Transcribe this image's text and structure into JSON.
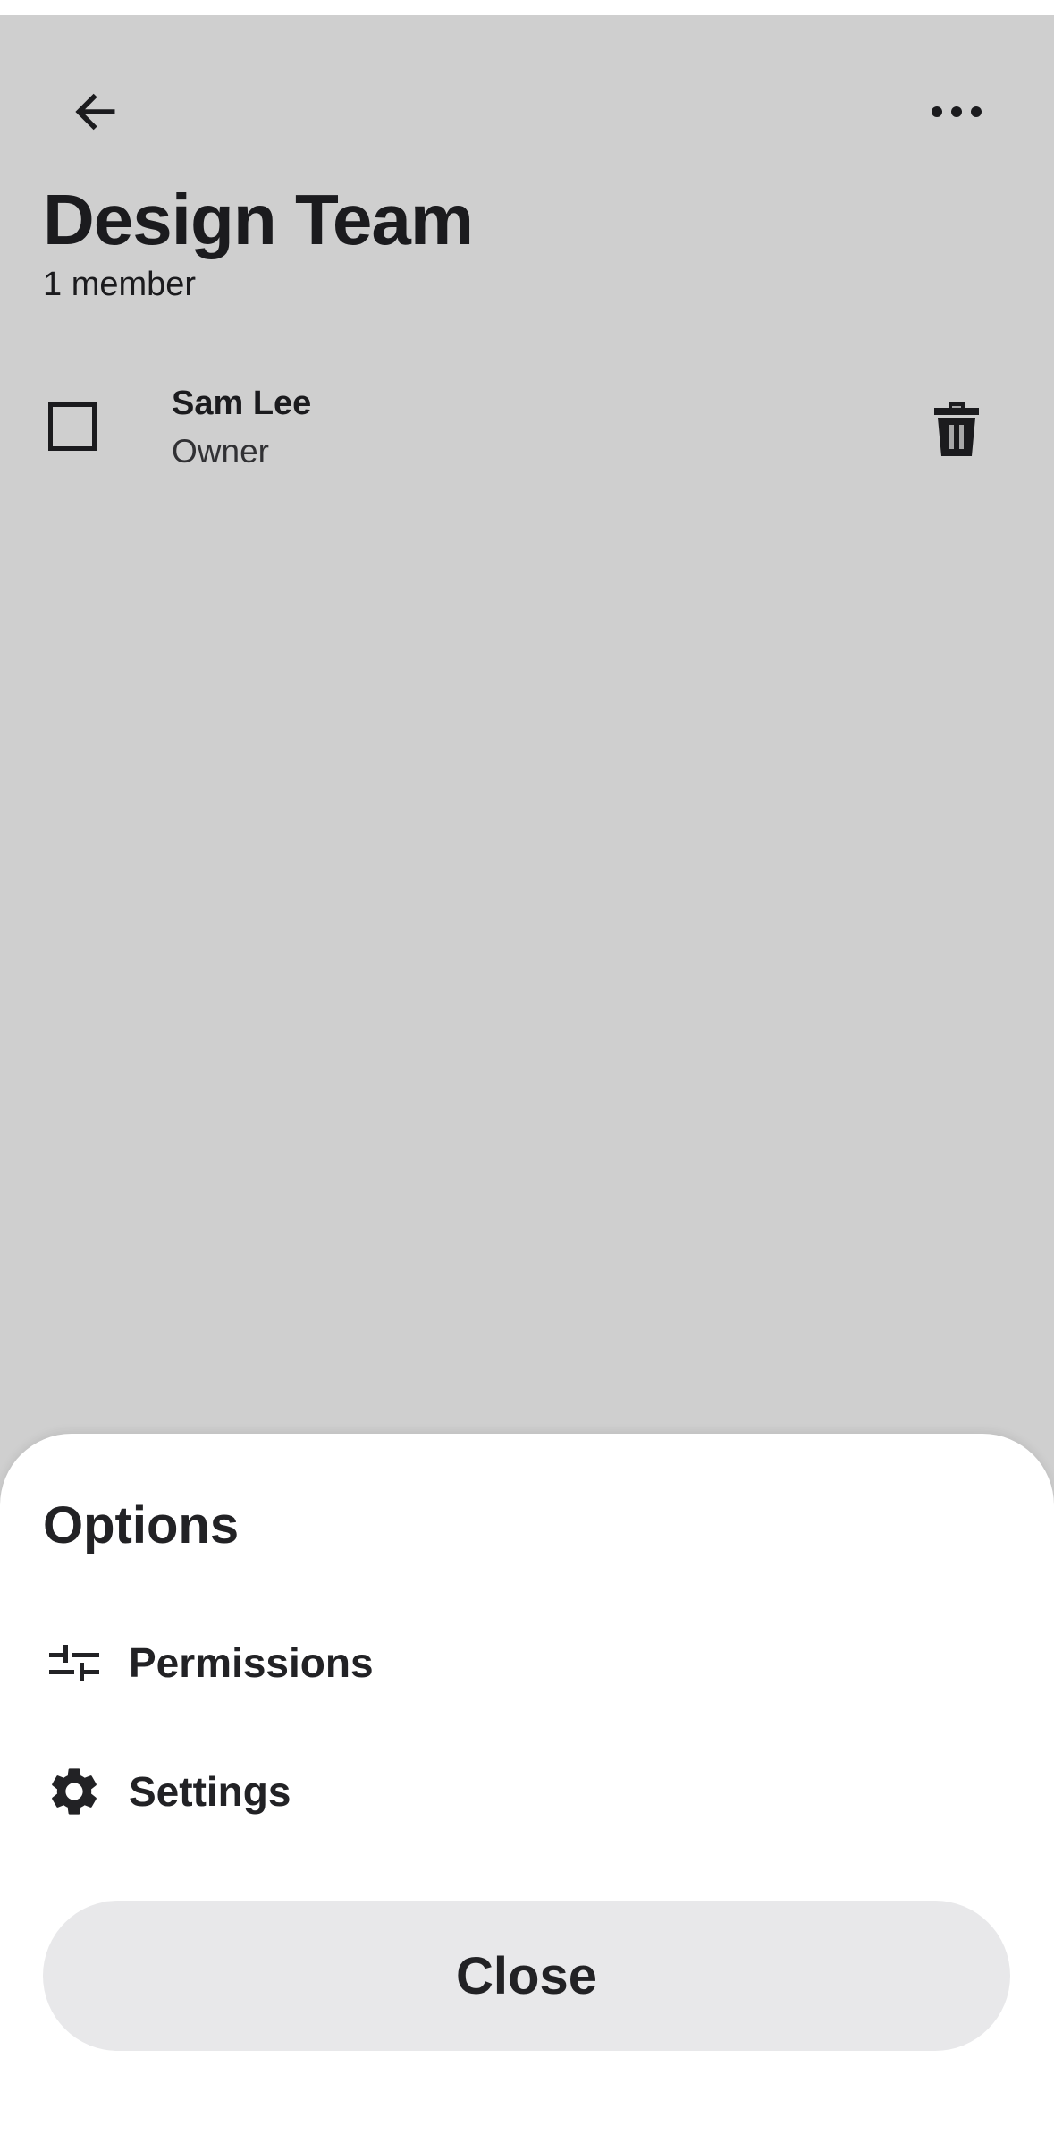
{
  "header": {
    "back_icon": "arrow-left-icon",
    "more_icon": "more-horizontal-icon",
    "title": "Design Team",
    "subtitle": "1 member"
  },
  "members": [
    {
      "name": "Sam Lee",
      "role": "Owner",
      "checked": false,
      "action_icon": "trash-icon"
    }
  ],
  "sheet": {
    "title": "Options",
    "items": [
      {
        "label": "Permissions",
        "icon": "sliders-icon"
      },
      {
        "label": "Settings",
        "icon": "gear-icon"
      }
    ],
    "close_label": "Close"
  },
  "colors": {
    "text": "#222225",
    "scrim": "rgba(0,0,0,0.19)",
    "button_bg": "#e8e8ea",
    "sheet_bg": "#ffffff"
  }
}
